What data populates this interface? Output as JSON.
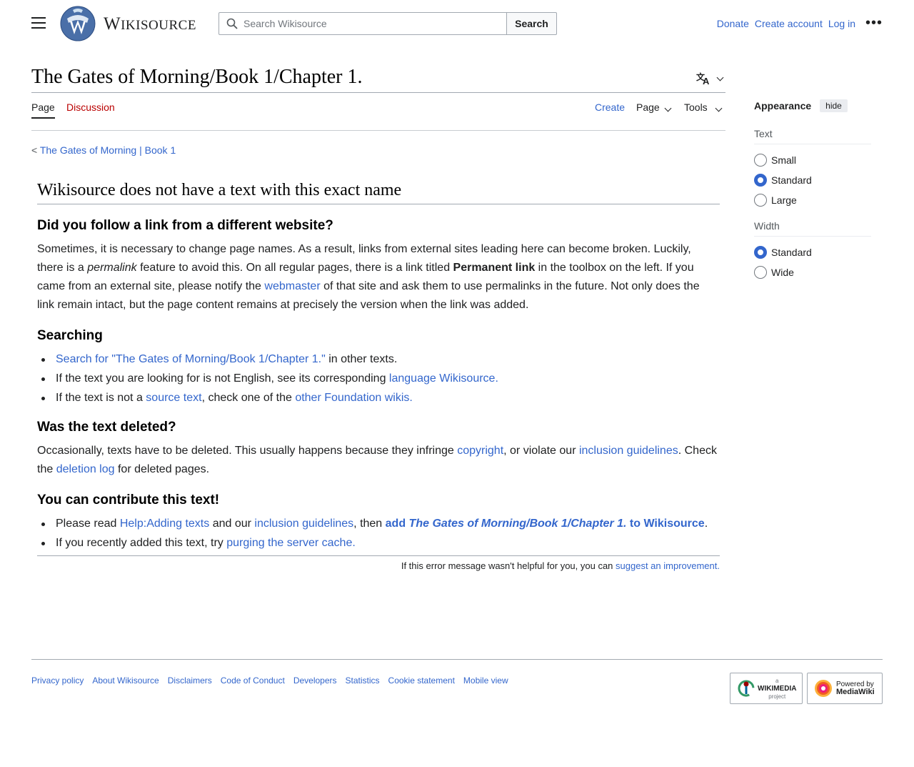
{
  "header": {
    "wordmark_first": "W",
    "wordmark_rest": "IKISOURCE",
    "search_placeholder": "Search Wikisource",
    "search_button": "Search",
    "user_links": [
      "Donate",
      "Create account",
      "Log in"
    ],
    "more": "•••"
  },
  "title": "The Gates of Morning/Book 1/Chapter 1.",
  "tabs": {
    "page": "Page",
    "discussion": "Discussion",
    "create": "Create",
    "page_menu": "Page",
    "tools": "Tools"
  },
  "breadcrumb": {
    "prefix": "< ",
    "link1": "The Gates of Morning",
    "sep": " | ",
    "link2": "Book 1"
  },
  "content": {
    "heading": "Wikisource does not have a text with this exact name",
    "s1": {
      "title": "Did you follow a link from a different website?",
      "t1": "Sometimes, it is necessary to change page names. As a result, links from external sites leading here can become broken. Luckily, there is a ",
      "t2_italic": "permalink",
      "t3": " feature to avoid this. On all regular pages, there is a link titled ",
      "t4_bold": "Permanent link",
      "t5": " in the toolbox on the left. If you came from an external site, please notify the ",
      "t6_link": "webmaster",
      "t7": " of that site and ask them to use permalinks in the future. Not only does the link remain intact, but the page content remains at precisely the version when the link was added."
    },
    "s2": {
      "title": "Searching",
      "li1_link": "Search for \"The Gates of Morning/Book 1/Chapter 1.\"",
      "li1_rest": " in other texts.",
      "li2_text": "If the text you are looking for is not English, see its corresponding ",
      "li2_link": "language Wikisource.",
      "li3_text": "If the text is not a ",
      "li3_link1": "source text",
      "li3_mid": ", check one of the ",
      "li3_link2": "other Foundation wikis."
    },
    "s3": {
      "title": "Was the text deleted?",
      "t1": "Occasionally, texts have to be deleted. This usually happens because they infringe ",
      "l1": "copyright",
      "t2": ", or violate our ",
      "l2": "inclusion guidelines",
      "t3": ". Check the ",
      "l3": "deletion log",
      "t4": " for deleted pages."
    },
    "s4": {
      "title": "You can contribute this text!",
      "li1_t1": "Please read ",
      "li1_l1": "Help:Adding texts",
      "li1_t2": " and our ",
      "li1_l2": "inclusion guidelines",
      "li1_t3": ", then ",
      "li1_l3a": "add ",
      "li1_l3b": "The Gates of Morning/Book 1/Chapter 1.",
      "li1_l3c": " to Wikisource",
      "li1_t4": ".",
      "li2_t1": "If you recently added this text, try ",
      "li2_l1": "purging the server cache."
    },
    "helpful_text": "If this error message wasn't helpful for you, you can ",
    "helpful_link": "suggest an improvement."
  },
  "appearance": {
    "title": "Appearance",
    "hide": "hide",
    "text_label": "Text",
    "text_options": [
      "Small",
      "Standard",
      "Large"
    ],
    "text_selected": "Standard",
    "width_label": "Width",
    "width_options": [
      "Standard",
      "Wide"
    ],
    "width_selected": "Standard"
  },
  "footer": {
    "links": [
      "Privacy policy",
      "About Wikisource",
      "Disclaimers",
      "Code of Conduct",
      "Developers",
      "Statistics",
      "Cookie statement",
      "Mobile view"
    ],
    "wikimedia_small": "a",
    "wikimedia_big": "WIKIMEDIA",
    "wikimedia_sub": "project",
    "mediawiki_top": "Powered by",
    "mediawiki_big": "MediaWiki"
  },
  "colors": {
    "link": "#3366cc",
    "discussion_red": "#ba0000",
    "radio_selected": "#3366cc"
  }
}
